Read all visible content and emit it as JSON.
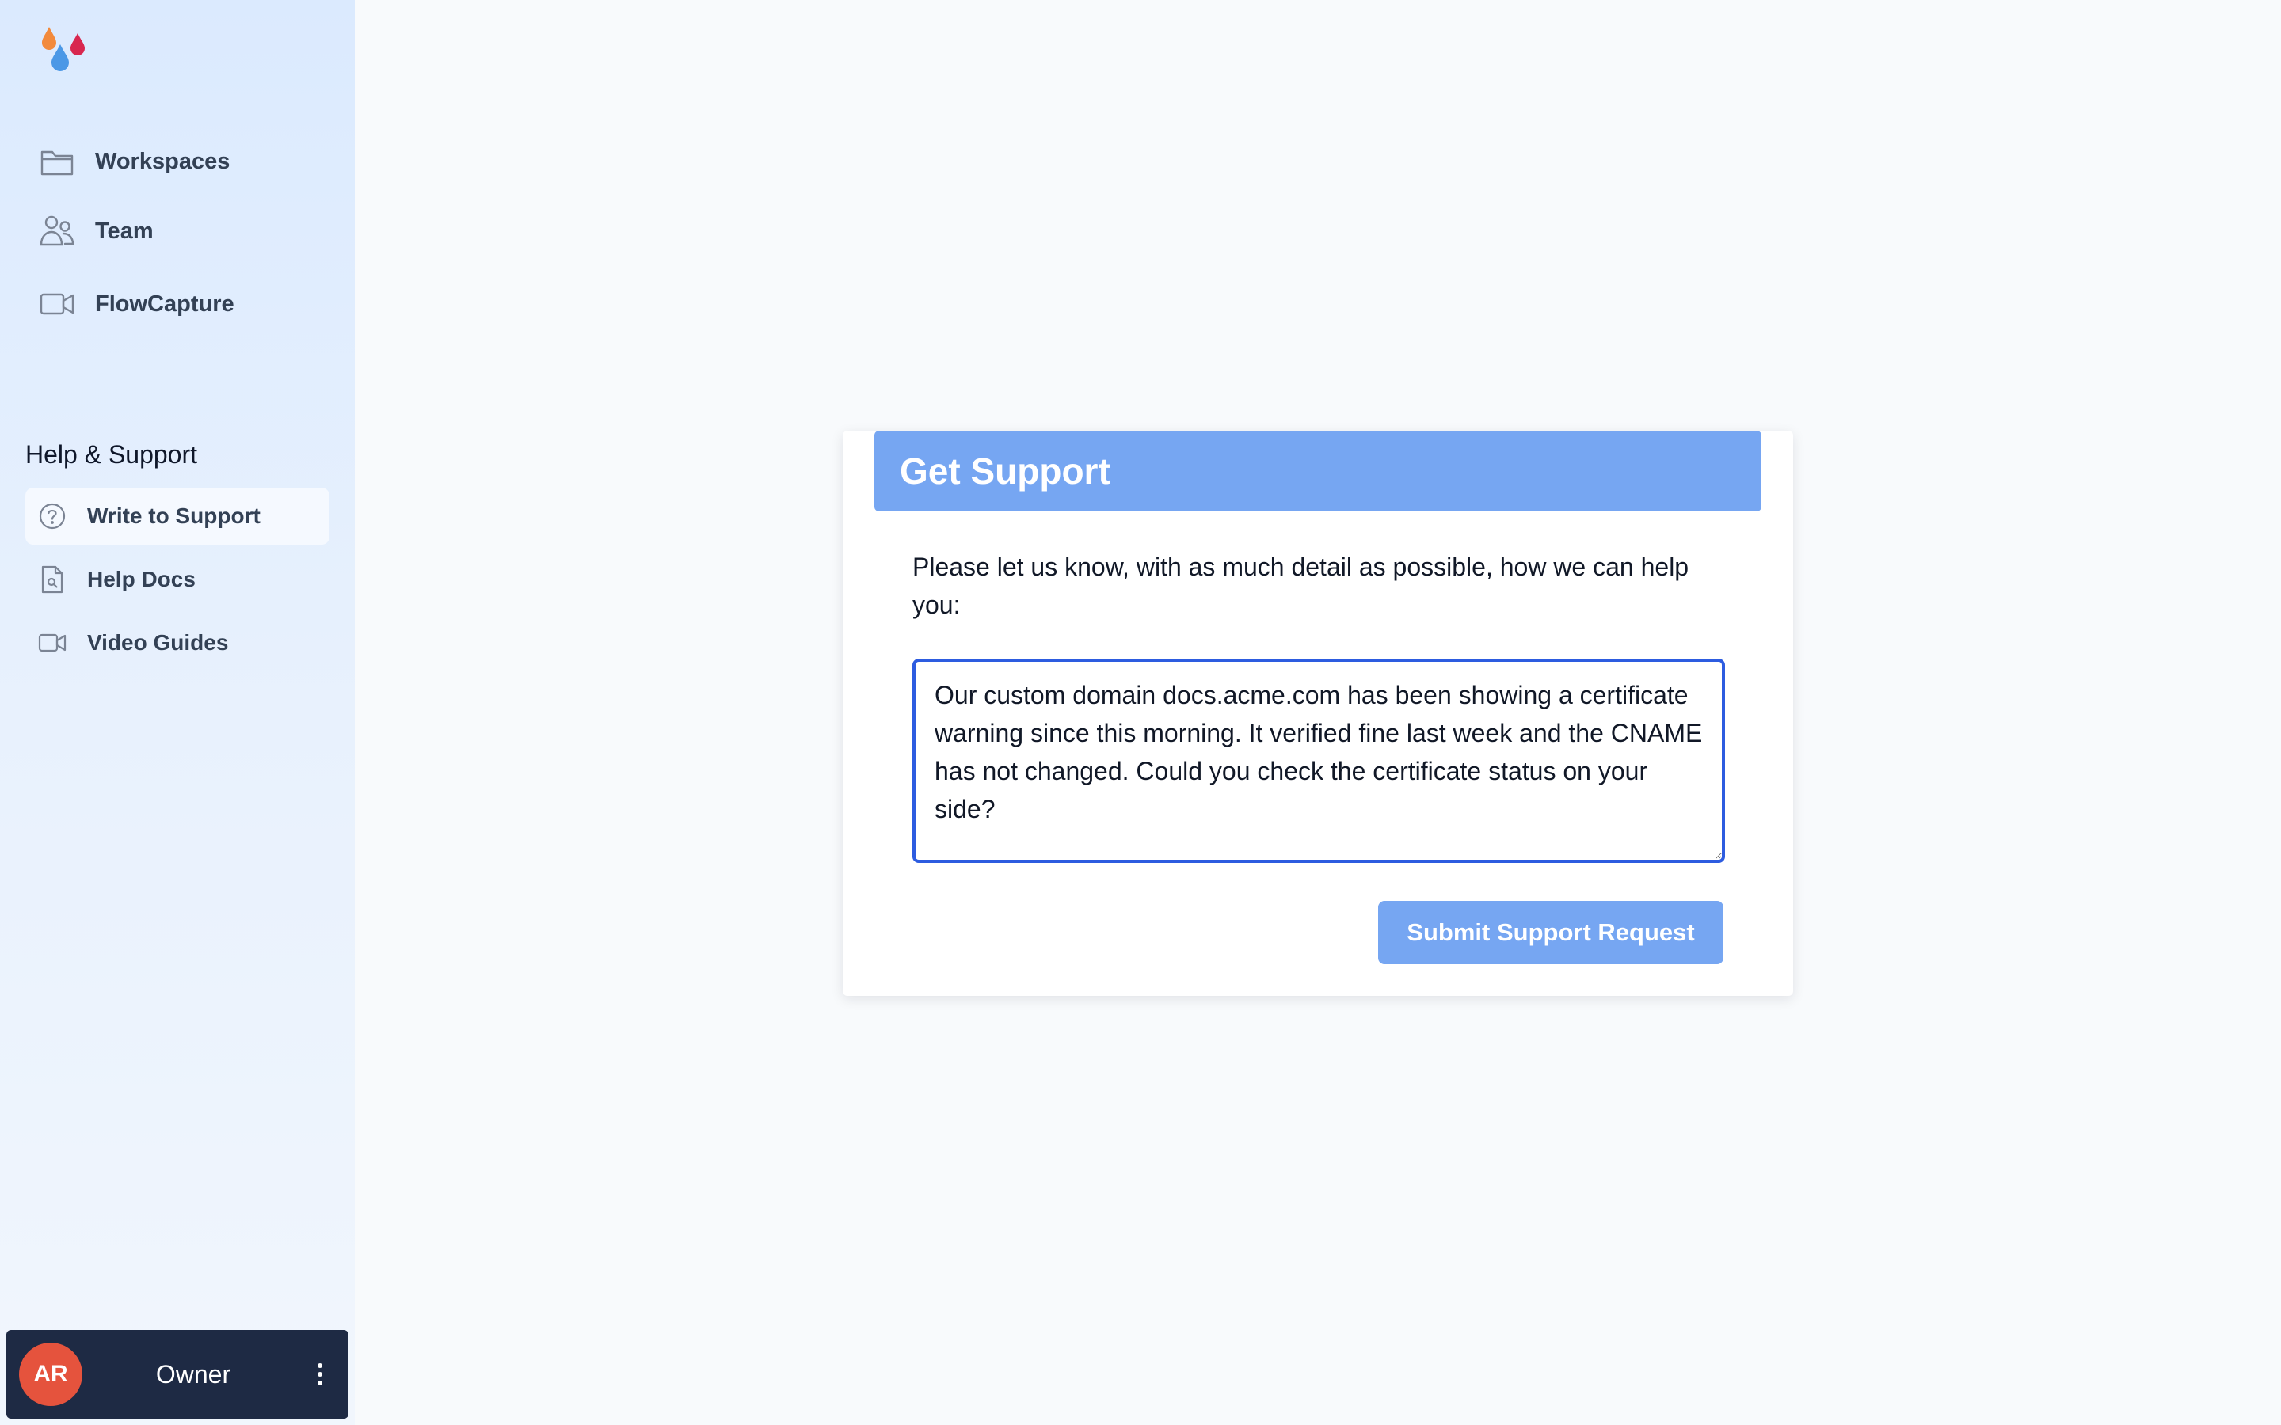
{
  "sidebar": {
    "logo_icon": "water-drops-logo",
    "nav": [
      {
        "label": "Workspaces",
        "icon": "folder-icon"
      },
      {
        "label": "Team",
        "icon": "users-icon"
      },
      {
        "label": "FlowCapture",
        "icon": "video-camera-icon"
      }
    ],
    "support_title": "Help & Support",
    "support_items": [
      {
        "label": "Write to Support",
        "icon": "question-circle-icon",
        "active": true
      },
      {
        "label": "Help Docs",
        "icon": "document-search-icon",
        "active": false
      },
      {
        "label": "Video Guides",
        "icon": "video-camera-icon",
        "active": false
      }
    ],
    "user": {
      "initials": "AR",
      "role": "Owner",
      "avatar_color": "#e5533d"
    }
  },
  "support_form": {
    "title": "Get Support",
    "description": "Please let us know, with as much detail as possible, how we can help you:",
    "message": "Our custom domain docs.acme.com has been showing a certificate warning since this morning. It verified fine last week and the CNAME has not changed. Could you check the certificate status on your side?",
    "submit_label": "Submit Support Request"
  },
  "colors": {
    "accent": "#76a6f2",
    "focus_border": "#2d5ce0",
    "user_bar": "#1e2a44"
  }
}
